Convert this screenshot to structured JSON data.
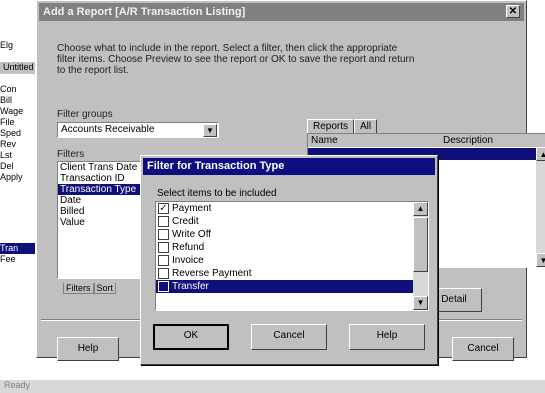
{
  "window": {
    "title": "Add a Report [A/R Transaction Listing]",
    "close_glyph": "✕"
  },
  "intro_text": "Choose what to include in the report. Select a filter, then click the appropriate filter items. Choose Preview to see the report or OK to save the report and return to the report list.",
  "filter_groups": {
    "label": "Filter groups",
    "value": "Accounts Receivable"
  },
  "filters": {
    "label": "Filters",
    "items": [
      {
        "label": "Client Trans Date",
        "selected": false
      },
      {
        "label": "Transaction ID",
        "selected": false
      },
      {
        "label": "Transaction Type",
        "selected": true
      },
      {
        "label": "Date",
        "selected": false
      },
      {
        "label": "Billed",
        "selected": false
      },
      {
        "label": "Value",
        "selected": false
      }
    ]
  },
  "bottom_tabs": {
    "tab1": "Filters",
    "tab2": "Sort"
  },
  "right_tabs": {
    "tab1": "Reports",
    "tab2": "All"
  },
  "right_list": {
    "col1": "Name",
    "col2": "Description"
  },
  "buttons": {
    "help": "Help",
    "cancel": "Cancel",
    "detail": "Detail"
  },
  "background": {
    "left_title": "Untitled",
    "left_rows": [
      "Elg",
      "Con",
      "Bill",
      "Wage",
      "File",
      "Sped",
      "Rev",
      "Lst",
      "Del",
      "Apply",
      "Tran",
      "Fee"
    ],
    "left_selected_index": 10,
    "status_text": "Ready"
  },
  "filter_dialog": {
    "title": "Filter for Transaction Type",
    "prompt": "Select items to be included",
    "items": [
      {
        "label": "Payment",
        "checked": true,
        "selected": false
      },
      {
        "label": "Credit",
        "checked": false,
        "selected": false
      },
      {
        "label": "Write Off",
        "checked": false,
        "selected": false
      },
      {
        "label": "Refund",
        "checked": false,
        "selected": false
      },
      {
        "label": "Invoice",
        "checked": false,
        "selected": false
      },
      {
        "label": "Reverse Payment",
        "checked": false,
        "selected": false
      },
      {
        "label": "Transfer",
        "checked": false,
        "selected": true
      }
    ],
    "ok_label": "OK",
    "cancel_label": "Cancel",
    "help_label": "Help"
  },
  "colors": {
    "selection": "#10107a",
    "dialog_title": "#0e0e80",
    "face": "#c0c0c0"
  }
}
